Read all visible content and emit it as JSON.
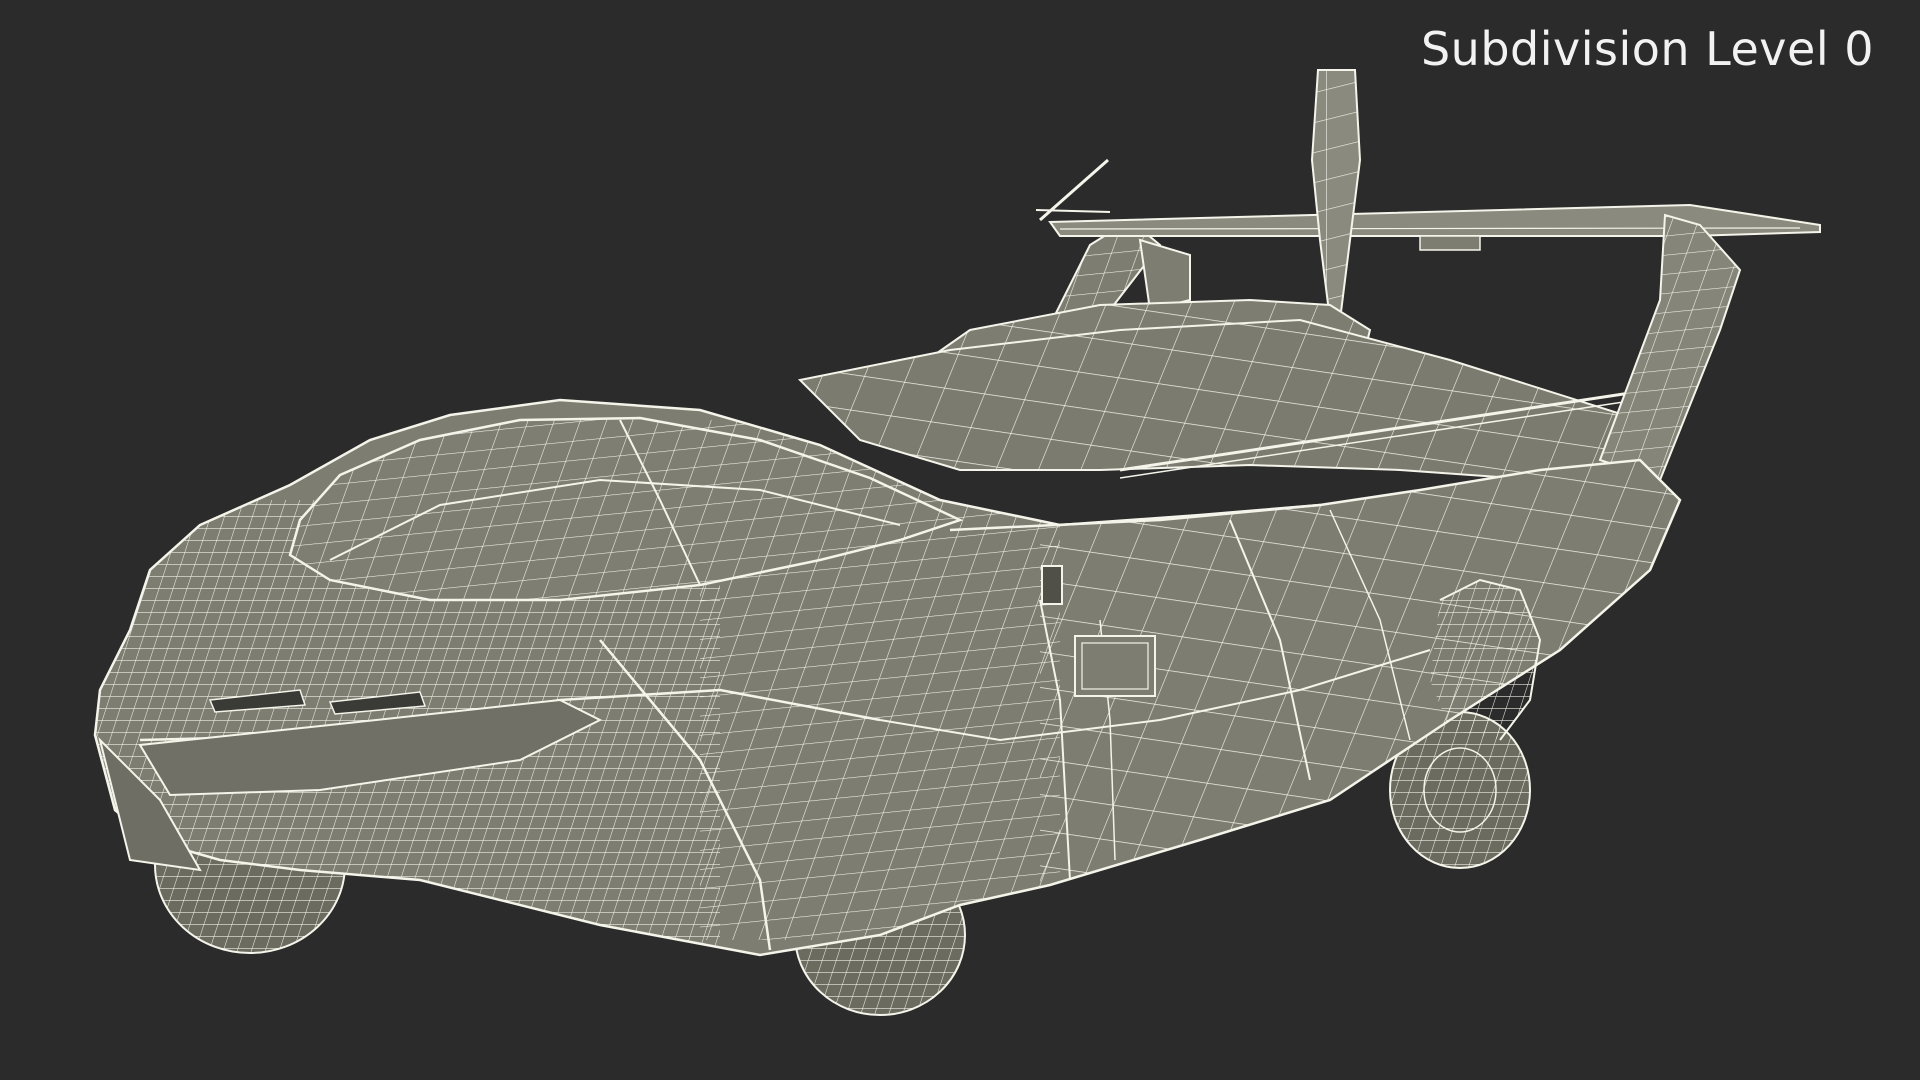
{
  "viewport": {
    "subdivision_label": "Subdivision Level 0",
    "background_color": "#2b2b2b",
    "mesh_fill_color": "#7d7d72",
    "wire_color": "#f4f4ea"
  }
}
